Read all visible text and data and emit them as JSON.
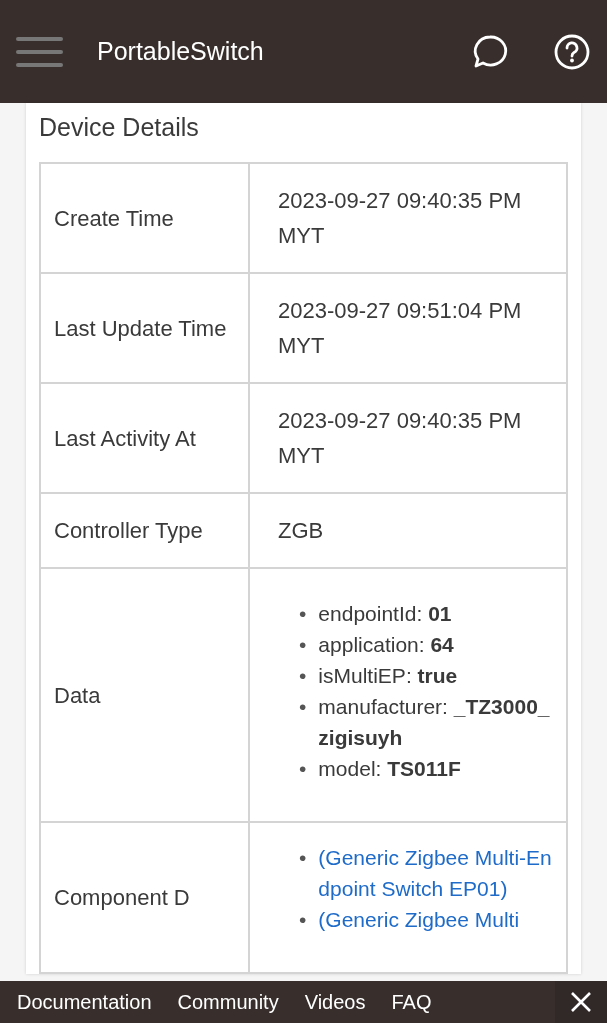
{
  "header": {
    "title": "PortableSwitch"
  },
  "card": {
    "title": "Device Details",
    "rows": [
      {
        "kind": "text",
        "label": "Create Time",
        "value": "2023-09-27 09:40:35 PM MYT"
      },
      {
        "kind": "text",
        "label": "Last Update Time",
        "value": "2023-09-27 09:51:04 PM MYT"
      },
      {
        "kind": "text",
        "label": "Last Activity At",
        "value": "2023-09-27 09:40:35 PM MYT"
      },
      {
        "kind": "text",
        "label": "Controller Type",
        "value": "ZGB"
      },
      {
        "kind": "list",
        "label": "Data",
        "items": [
          {
            "bullet": "•",
            "text": "endpointId: **01**"
          },
          {
            "bullet": "•",
            "text": "application: **64**"
          },
          {
            "bullet": "•",
            "text": "isMultiEP: **true**"
          },
          {
            "bullet": "•",
            "text": "manufacturer: **_TZ3000_zigisuyh**"
          },
          {
            "bullet": "•",
            "text": "model: **TS011F**"
          }
        ]
      },
      {
        "kind": "links",
        "label": "Component D",
        "items": [
          {
            "bullet": "•",
            "text": "(Generic Zigbee Multi-Endpoint Switch EP01)"
          },
          {
            "bullet": "•",
            "text": "(Generic Zigbee Multi"
          }
        ]
      }
    ]
  },
  "footer": {
    "links": [
      "Documentation",
      "Community",
      "Videos",
      "FAQ"
    ]
  }
}
